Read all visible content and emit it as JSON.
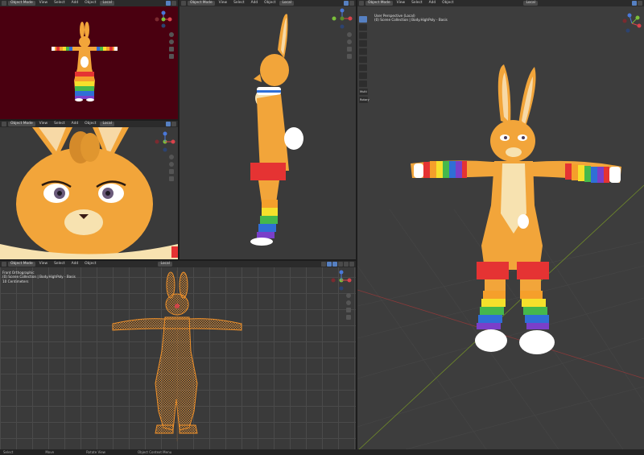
{
  "viewports": {
    "top_left": {
      "mode": "Object Mode",
      "menus": [
        "View",
        "Select",
        "Add",
        "Object"
      ],
      "orientation": "Local"
    },
    "mid_left": {
      "mode": "Object Mode",
      "menus": [
        "View",
        "Select",
        "Add",
        "Object"
      ],
      "orientation": "Local"
    },
    "center": {
      "mode": "Object Mode",
      "menus": [
        "View",
        "Select",
        "Add",
        "Object"
      ],
      "orientation": "Local"
    },
    "bottom": {
      "mode": "Object Mode",
      "menus": [
        "View",
        "Select",
        "Add",
        "Object"
      ],
      "orientation": "Local",
      "info": [
        "Front Orthographic",
        "(0) Scene Collection | Body.HighPoly - Basis",
        "10 Centimeters"
      ]
    },
    "right": {
      "mode": "Object Mode",
      "menus": [
        "View",
        "Select",
        "Add",
        "Object"
      ],
      "orientation": "Local",
      "info": [
        "User Perspective (Local)",
        "(0) Scene Collection | Body.HighPoly - Basis"
      ],
      "tool_labels": [
        "Multi",
        "Rotary"
      ]
    }
  },
  "status_bar": {
    "items": [
      "Select",
      "Move",
      "Rotate View",
      "Object Context Menu"
    ]
  },
  "colors": {
    "accent": "#5680c2",
    "fur": "#f2a53a",
    "belly": "#f7e2b0",
    "red_bg": "#4a0010",
    "wire": "#f0912a"
  }
}
